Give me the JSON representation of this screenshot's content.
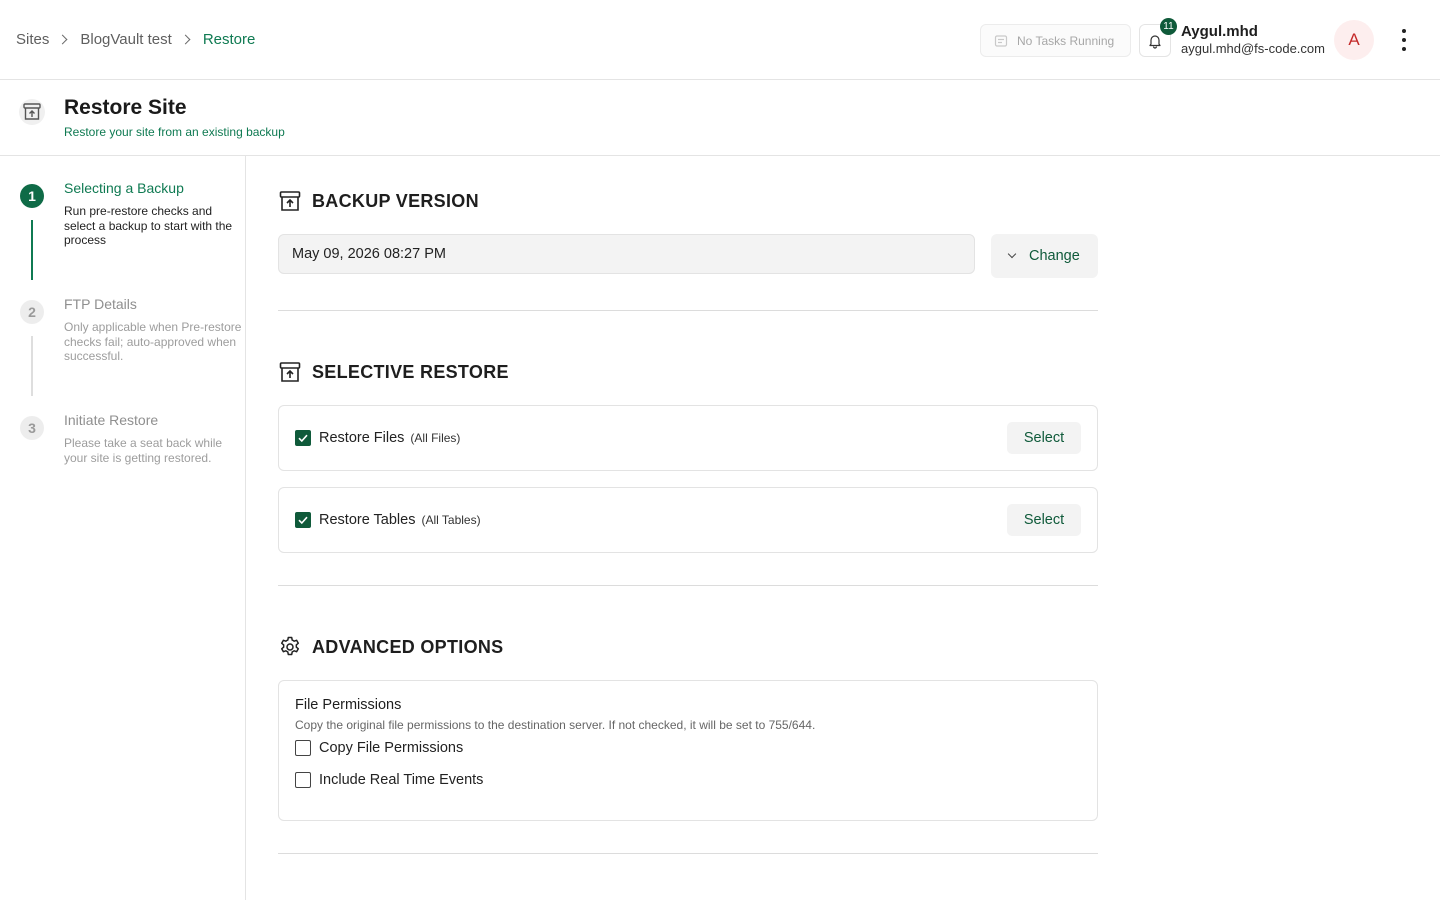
{
  "breadcrumb": {
    "items": [
      "Sites",
      "BlogVault test"
    ],
    "current": "Restore"
  },
  "header": {
    "tasks_label": "No Tasks Running",
    "notification_count": "11",
    "user_name": "Aygul.mhd",
    "user_email": "aygul.mhd@fs-code.com",
    "avatar_initial": "A"
  },
  "page": {
    "title": "Restore Site",
    "subtitle": "Restore your site from an existing backup"
  },
  "steps": [
    {
      "number": "1",
      "title": "Selecting a Backup",
      "description": "Run pre-restore checks and select a backup to start with the process",
      "state": "active"
    },
    {
      "number": "2",
      "title": "FTP Details",
      "description": "Only applicable when Pre-restore checks fail; auto-approved when successful.",
      "state": "inactive"
    },
    {
      "number": "3",
      "title": "Initiate Restore",
      "description": "Please take a seat back while your site is getting restored.",
      "state": "inactive"
    }
  ],
  "backup_version": {
    "heading": "BACKUP VERSION",
    "value": "May 09, 2026 08:27 PM",
    "change_label": "Change"
  },
  "selective_restore": {
    "heading": "SELECTIVE RESTORE",
    "files": {
      "label": "Restore Files",
      "scope": "(All Files)",
      "checked": true,
      "button": "Select"
    },
    "tables": {
      "label": "Restore Tables",
      "scope": "(All Tables)",
      "checked": true,
      "button": "Select"
    }
  },
  "advanced": {
    "heading": "ADVANCED OPTIONS",
    "title": "File Permissions",
    "description": "Copy the original file permissions to the destination server. If not checked, it will be set to 755/644.",
    "options": [
      {
        "label": "Copy File Permissions",
        "checked": false
      },
      {
        "label": "Include Real Time Events",
        "checked": false
      }
    ]
  },
  "colors": {
    "accent": "#0f7a52",
    "accent_dark": "#0f5a3a",
    "avatar_bg": "#fdeeee",
    "avatar_text": "#c42a2a"
  },
  "icons": [
    "chevron-right-icon",
    "tasks-icon",
    "bell-icon",
    "kebab-menu-icon",
    "archive-upload-icon",
    "gear-icon",
    "chevron-down-icon",
    "checkmark-icon"
  ]
}
